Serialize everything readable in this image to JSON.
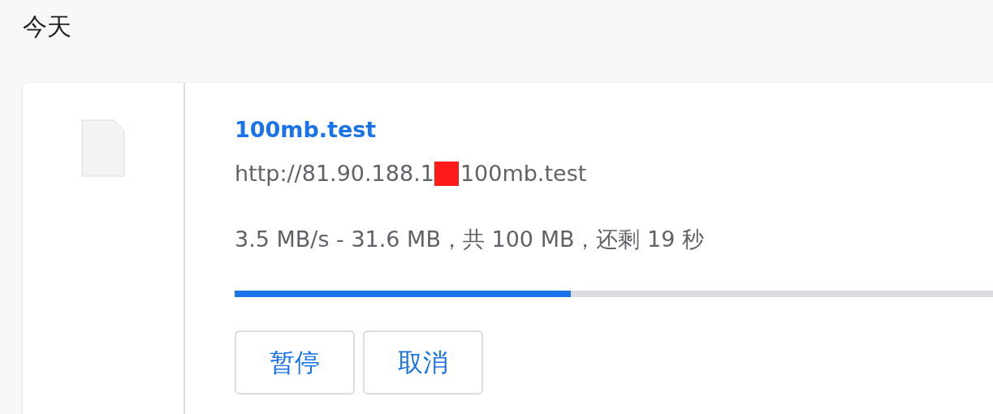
{
  "section_title": "今天",
  "download": {
    "file_name": "100mb.test",
    "url_start": "http://81.90.188.1",
    "url_redacted": true,
    "url_end": "100mb.test",
    "status": "3.5 MB/s - 31.6 MB，共 100 MB，还剩 19 秒",
    "level": 0.44
  },
  "buttons": [
    {
      "label": "暂停"
    },
    {
      "label": "取消"
    }
  ]
}
